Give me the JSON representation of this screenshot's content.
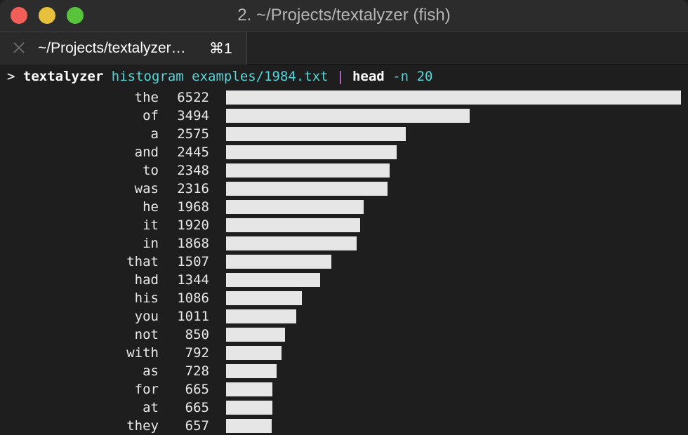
{
  "window": {
    "title": "2. ~/Projects/textalyzer (fish)",
    "controls": [
      "close",
      "minimize",
      "zoom"
    ]
  },
  "tab": {
    "label": "~/Projects/textalyzer…",
    "shortcut": "⌘1",
    "close_icon": "close-icon"
  },
  "terminal": {
    "prompt": ">",
    "command": {
      "bin": "textalyzer",
      "subcommand": "histogram examples/1984.txt",
      "pipe": "|",
      "head_bin": "head",
      "head_args": "-n 20"
    }
  },
  "chart_data": {
    "type": "bar",
    "orientation": "horizontal",
    "categories": [
      "the",
      "of",
      "a",
      "and",
      "to",
      "was",
      "he",
      "it",
      "in",
      "that",
      "had",
      "his",
      "you",
      "not",
      "with",
      "as",
      "for",
      "at",
      "they"
    ],
    "values": [
      6522,
      3494,
      2575,
      2445,
      2348,
      2316,
      1968,
      1920,
      1868,
      1507,
      1344,
      1086,
      1011,
      850,
      792,
      728,
      665,
      665,
      657
    ],
    "series": [
      {
        "values": [
          6522,
          3494,
          2575,
          2445,
          2348,
          2316,
          1968,
          1920,
          1868,
          1507,
          1344,
          1086,
          1011,
          850,
          792,
          728,
          665,
          665,
          657
        ]
      }
    ],
    "xlim": [
      0,
      6522
    ],
    "colors": {
      "bar": "#e6e6e6",
      "background": "#1e1e1e"
    }
  }
}
